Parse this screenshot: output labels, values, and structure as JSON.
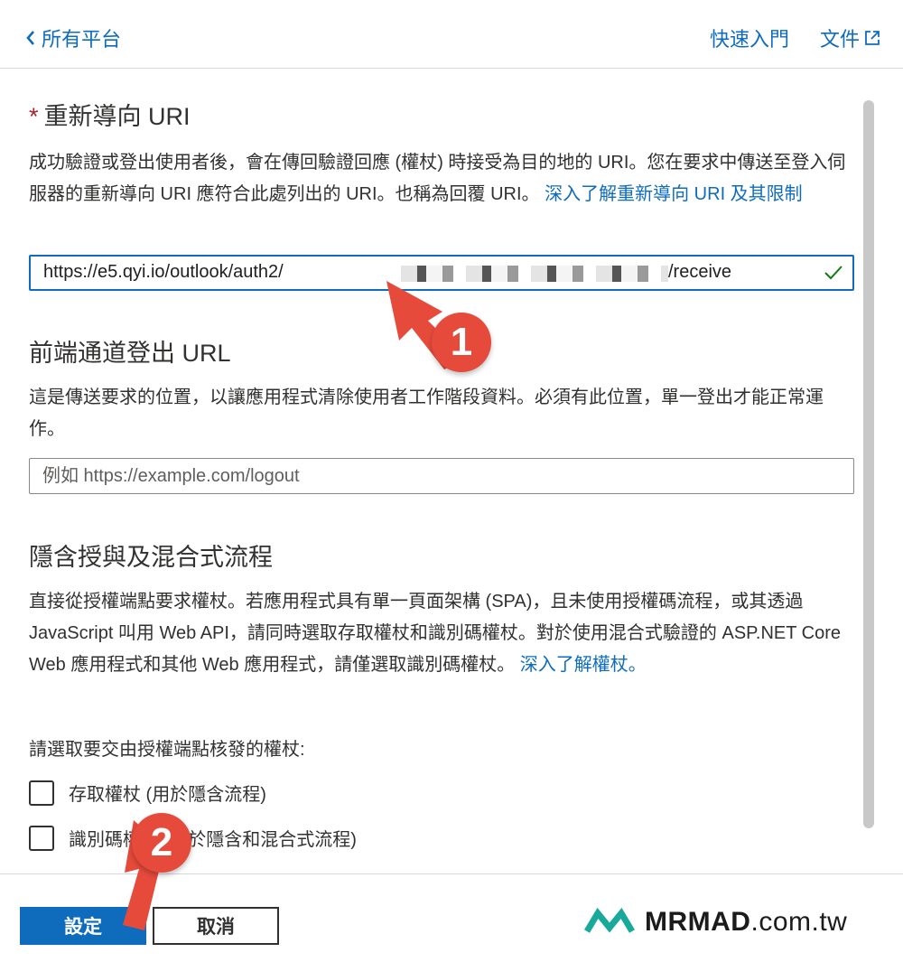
{
  "header": {
    "back_label": "所有平台",
    "quickstart_label": "快速入門",
    "docs_label": "文件"
  },
  "redirect": {
    "required_mark": "*",
    "title": "重新導向 URI",
    "desc_text": "成功驗證或登出使用者後，會在傳回驗證回應 (權杖) 時接受為目的地的 URI。您在要求中傳送至登入伺服器的重新導向 URI 應符合此處列出的 URI。也稱為回覆 URI。 ",
    "desc_link": "深入了解重新導向 URI 及其限制",
    "uri_prefix": "https://e5.qyi.io/outlook/auth2/",
    "uri_suffix": "/receive"
  },
  "logout": {
    "title": "前端通道登出 URL",
    "desc_text": "這是傳送要求的位置，以讓應用程式清除使用者工作階段資料。必須有此位置，單一登出才能正常運作。",
    "placeholder": "例如 https://example.com/logout"
  },
  "implicit": {
    "title": "隱含授與及混合式流程",
    "desc_text": "直接從授權端點要求權杖。若應用程式具有單一頁面架構 (SPA)，且未使用授權碼流程，或其透過 JavaScript 叫用 Web API，請同時選取存取權杖和識別碼權杖。對於使用混合式驗證的 ASP.NET Core Web 應用程式和其他 Web 應用程式，請僅選取識別碼權杖。 ",
    "desc_link": "深入了解權杖。",
    "select_prompt": "請選取要交由授權端點核發的權杖:",
    "access_token_label": "存取權杖 (用於隱含流程)",
    "id_token_label": "識別碼權杖 (用於隱含和混合式流程)"
  },
  "footer": {
    "configure_label": "設定",
    "cancel_label": "取消"
  },
  "watermark": {
    "brand_bold": "MRMAD",
    "brand_domain": ".com.tw"
  },
  "annotations": {
    "step1": "1",
    "step2": "2"
  },
  "colors": {
    "accent": "#0f6cbd",
    "annotation_red": "#e64a3b",
    "valid_check": "#107c10",
    "required": "#a4262c"
  }
}
